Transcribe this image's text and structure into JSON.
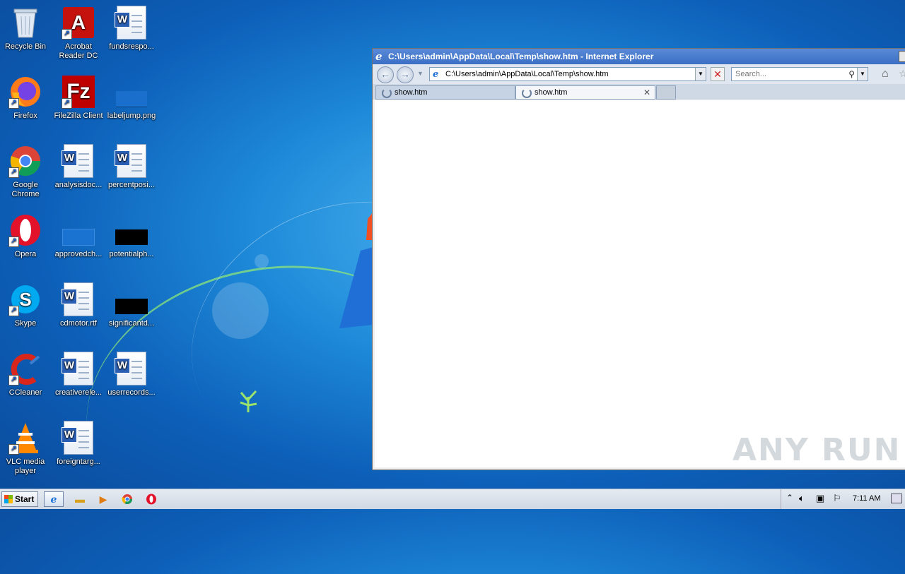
{
  "desktop": {
    "icons": [
      {
        "label": "Recycle Bin"
      },
      {
        "label": "Acrobat Reader DC"
      },
      {
        "label": "fundsrespo..."
      },
      {
        "label": "Firefox"
      },
      {
        "label": "FileZilla Client"
      },
      {
        "label": "labeljump.png"
      },
      {
        "label": "Google Chrome"
      },
      {
        "label": "analysisdoc..."
      },
      {
        "label": "percentposi..."
      },
      {
        "label": "Opera"
      },
      {
        "label": "approvedch..."
      },
      {
        "label": "potentialph..."
      },
      {
        "label": "Skype"
      },
      {
        "label": "cdmotor.rtf"
      },
      {
        "label": "significantd..."
      },
      {
        "label": "CCleaner"
      },
      {
        "label": "creativerele..."
      },
      {
        "label": "userrecords..."
      },
      {
        "label": "VLC media player"
      },
      {
        "label": "foreigntarg..."
      }
    ]
  },
  "ie": {
    "title": "C:\\Users\\admin\\AppData\\Local\\Temp\\show.htm - Internet Explorer",
    "address": "C:\\Users\\admin\\AppData\\Local\\Temp\\show.htm",
    "search_placeholder": "Search...",
    "tabs": [
      {
        "label": "show.htm"
      },
      {
        "label": "show.htm"
      }
    ]
  },
  "taskbar": {
    "start_label": "Start",
    "clock": "7:11 AM"
  },
  "watermark": "ANY RUN"
}
